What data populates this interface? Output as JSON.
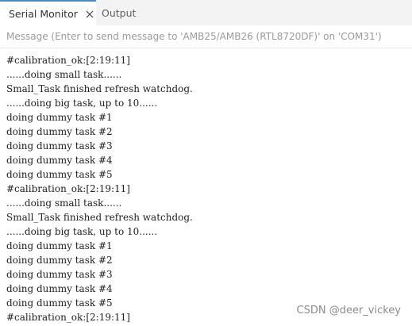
{
  "tabs": {
    "serial_monitor": "Serial Monitor",
    "output": "Output"
  },
  "message_bar": {
    "placeholder": "Message (Enter to send message to 'AMB25/AMB26 (RTL8720DF)' on 'COM31')",
    "value": ""
  },
  "console": {
    "lines": [
      "#calibration_ok:[2:19:11]",
      "......doing small task......",
      "Small_Task finished refresh watchdog.",
      "......doing big task, up to 10......",
      "doing dummy task #1",
      "doing dummy task #2",
      "doing dummy task #3",
      "doing dummy task #4",
      "doing dummy task #5",
      "#calibration_ok:[2:19:11]",
      "......doing small task......",
      "Small_Task finished refresh watchdog.",
      "......doing big task, up to 10......",
      "doing dummy task #1",
      "doing dummy task #2",
      "doing dummy task #3",
      "doing dummy task #4",
      "doing dummy task #5",
      "#calibration_ok:[2:19:11]"
    ]
  },
  "watermark": "CSDN @deer_vickey",
  "colors": {
    "tab_accent": "#4a8ac9",
    "tabbar_bg": "#f3f3f3",
    "text": "#1f1f1f",
    "placeholder": "#9a9a9a"
  },
  "icons": {
    "close": "close-icon"
  }
}
